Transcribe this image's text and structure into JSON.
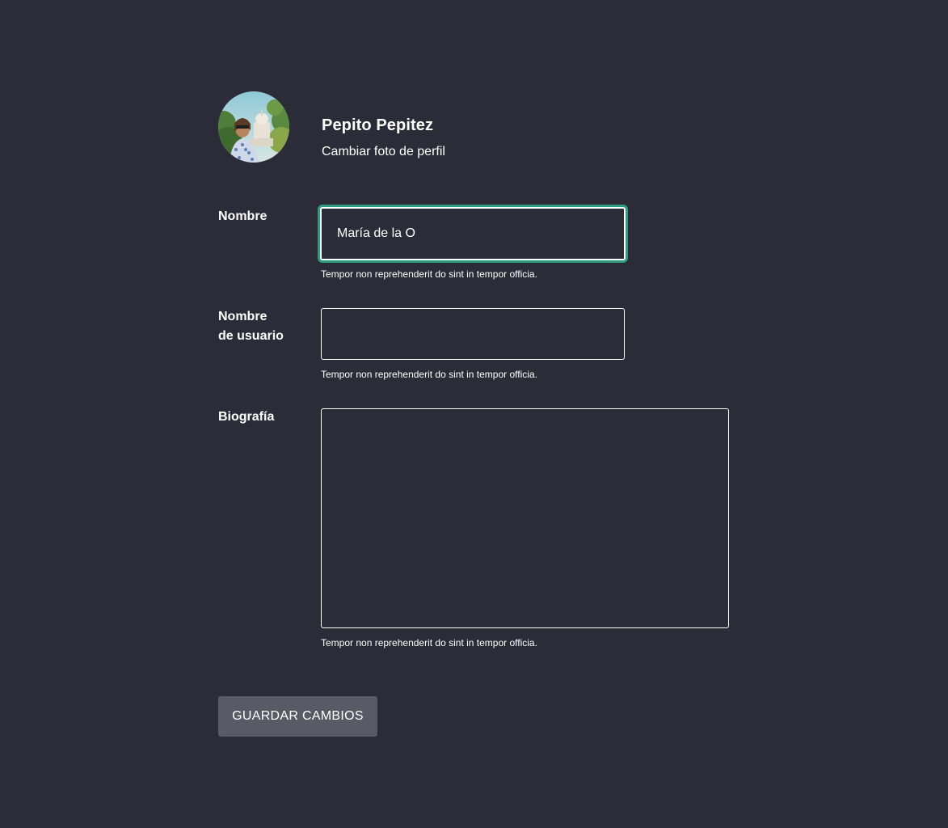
{
  "profile": {
    "name": "Pepito Pepitez",
    "change_photo_label": "Cambiar foto de perfil",
    "avatar_icon": "user-avatar-photo"
  },
  "form": {
    "nombre": {
      "label": "Nombre",
      "value": "María de la O",
      "helper": "Tempor non reprehenderit do sint in tempor officia."
    },
    "usuario": {
      "label_line1": "Nombre",
      "label_line2": "de usuario",
      "value": "",
      "helper": "Tempor non reprehenderit do sint in tempor officia."
    },
    "biografia": {
      "label": "Biografía",
      "value": "",
      "helper": "Tempor non reprehenderit do sint in tempor officia."
    },
    "save_label": "GUARDAR CAMBIOS"
  },
  "colors": {
    "background": "#2c2c38",
    "focus_ring": "#2e9e7f",
    "button": "#5a5a66",
    "text": "#ffffff"
  }
}
